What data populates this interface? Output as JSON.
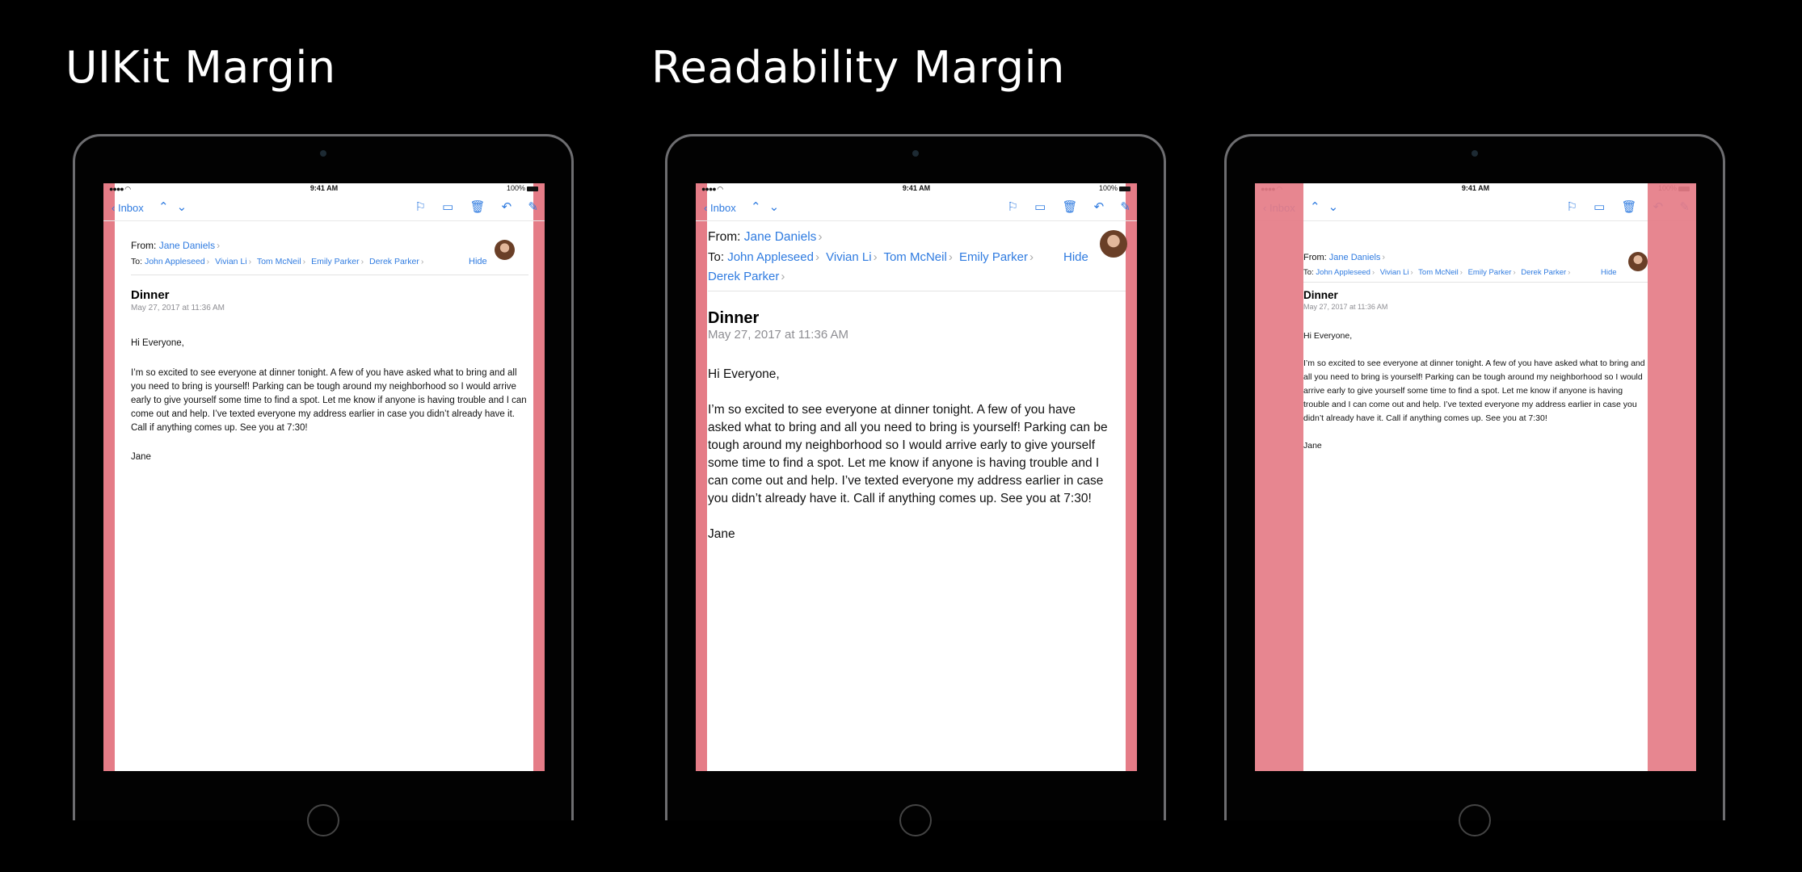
{
  "headings": {
    "left": "UIKit Margin",
    "center": "Readability Margin"
  },
  "status": {
    "time": "9:41 AM",
    "battery": "100%"
  },
  "toolbar": {
    "back": "Inbox"
  },
  "icons": [
    "chevron-left-icon",
    "chevron-up-icon",
    "chevron-down-icon",
    "flag-icon",
    "folder-icon",
    "trash-icon",
    "reply-icon",
    "compose-icon"
  ],
  "email": {
    "from_label": "From:",
    "from_name": "Jane Daniels",
    "to_label": "To:",
    "recipients": [
      "John Appleseed",
      "Vivian Li",
      "Tom McNeil",
      "Emily Parker",
      "Derek Parker"
    ],
    "hide": "Hide",
    "subject": "Dinner",
    "date": "May 27, 2017 at 11:36 AM",
    "greeting": "Hi Everyone,",
    "body": "I’m so excited to see everyone at dinner tonight. A few of you have asked what to bring and all you need to bring is yourself! Parking can be tough around my neighborhood so I would arrive early to give yourself some time to find a spot. Let me know if anyone is having trouble and I can come out and help. I’ve texted everyone my address earlier in case you didn’t already have it. Call if anything comes up. See you at 7:30!",
    "signature": "Jane"
  },
  "colors": {
    "margin": "#e57c87",
    "link": "#2f7be0",
    "background": "#000000"
  }
}
